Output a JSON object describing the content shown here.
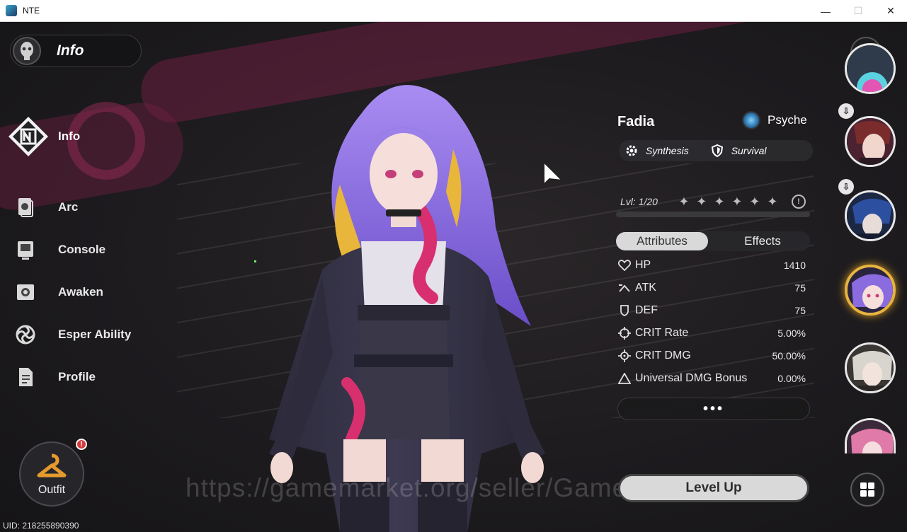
{
  "window": {
    "title": "NTE",
    "minimize_glyph": "—",
    "maximize_glyph": "☐",
    "close_glyph": "✕"
  },
  "header": {
    "title": "Info"
  },
  "nav": {
    "items": [
      {
        "label": "Info",
        "icon": "info-emblem-icon",
        "active": true
      },
      {
        "label": "Arc",
        "icon": "arc-card-icon",
        "active": false
      },
      {
        "label": "Console",
        "icon": "console-icon",
        "active": false
      },
      {
        "label": "Awaken",
        "icon": "awaken-icon",
        "active": false
      },
      {
        "label": "Esper Ability",
        "icon": "esper-swirl-icon",
        "active": false
      },
      {
        "label": "Profile",
        "icon": "profile-doc-icon",
        "active": false
      }
    ]
  },
  "outfit": {
    "label": "Outfit",
    "badge": "!"
  },
  "uid": "UID: 218255890390",
  "character": {
    "name": "Fadia",
    "element": "Psyche",
    "tags": [
      "Synthesis",
      "Survival"
    ],
    "level_text": "Lvl: 1/20",
    "level_current": 1,
    "level_max": 20,
    "stars_filled": 0,
    "stars_total": 6,
    "xp_fraction": 0.0
  },
  "tabs": {
    "attributes": "Attributes",
    "effects": "Effects",
    "active": "attributes"
  },
  "attributes": [
    {
      "name": "HP",
      "value": "1410",
      "icon": "heart-outline-icon"
    },
    {
      "name": "ATK",
      "value": "75",
      "icon": "atk-chevron-icon"
    },
    {
      "name": "DEF",
      "value": "75",
      "icon": "shield-outline-icon"
    },
    {
      "name": "CRIT Rate",
      "value": "5.00%",
      "icon": "crosshair-icon"
    },
    {
      "name": "CRIT DMG",
      "value": "50.00%",
      "icon": "crosshair-burst-icon"
    },
    {
      "name": "Universal DMG Bonus",
      "value": "0.00%",
      "icon": "triangle-icon"
    }
  ],
  "more": "•••",
  "level_up": "Level Up",
  "close": "✕",
  "watermark": "https://gamemarket.org/seller/GameNeko",
  "colors": {
    "accent_gold": "#e7b440",
    "band_magenta": "#6d1f40",
    "psyche_blue": "#7fd4ff"
  }
}
